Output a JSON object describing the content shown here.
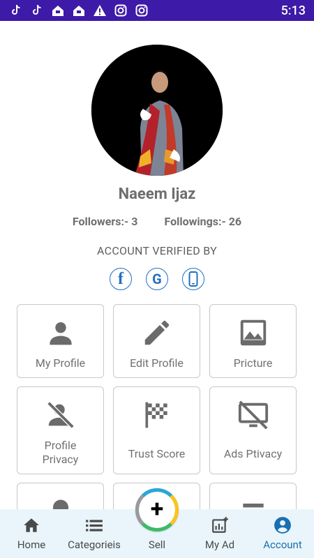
{
  "status_bar": {
    "time": "5:13",
    "icons": [
      "tiktok-icon",
      "tiktok-icon",
      "app-icon",
      "app-icon",
      "warning-icon",
      "instagram-icon",
      "instagram-icon"
    ]
  },
  "profile": {
    "name": "Naeem Ijaz",
    "followers_label": "Followers:- 3",
    "followings_label": "Followings:- 26"
  },
  "verification": {
    "title": "ACCOUNT VERIFIED BY",
    "badges": [
      {
        "icon": "facebook-icon",
        "glyph": "f"
      },
      {
        "icon": "google-icon",
        "glyph": "G"
      },
      {
        "icon": "phone-icon"
      }
    ]
  },
  "tiles": [
    {
      "label": "My Profile",
      "icon": "person-icon"
    },
    {
      "label": "Edit Profile",
      "icon": "pencil-icon"
    },
    {
      "label": "Pricture",
      "icon": "image-icon"
    },
    {
      "label": "Profile\nPrivacy",
      "icon": "person-off-icon"
    },
    {
      "label": "Trust Score",
      "icon": "checkered-flag-icon"
    },
    {
      "label": "Ads Ptivacy",
      "icon": "desktop-off-icon"
    },
    {
      "label": "",
      "icon": "bell-icon"
    },
    {
      "label": "",
      "icon": "blank-tile"
    },
    {
      "label": "",
      "icon": "list-icon"
    }
  ],
  "bottom_nav": {
    "items": [
      {
        "label": "Home",
        "icon": "home-icon"
      },
      {
        "label": "Categorieis",
        "icon": "list-icon"
      },
      {
        "label": "Sell",
        "icon": "plus-icon"
      },
      {
        "label": "My Ad",
        "icon": "chart-add-icon"
      },
      {
        "label": "Account",
        "icon": "account-circle-icon"
      }
    ],
    "active": "Account",
    "active_color": "#1a6fb0"
  },
  "colors": {
    "status_bar": "#3d1aa8",
    "accent_blue": "#1f6fc2",
    "nav_background": "#e9f5fb"
  }
}
